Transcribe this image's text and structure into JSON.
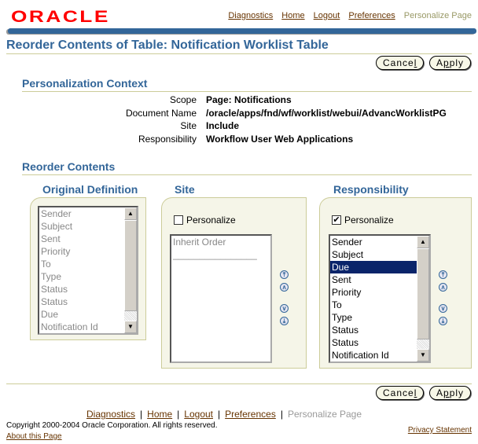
{
  "logo": "ORACLE",
  "global_nav": {
    "links": [
      "Diagnostics",
      "Home",
      "Logout",
      "Preferences"
    ],
    "disabled": "Personalize Page"
  },
  "page_title": "Reorder Contents of Table: Notification Worklist Table",
  "buttons": {
    "cancel": "Cance",
    "cancel_accel": "l",
    "apply_pre": "A",
    "apply_accel": "p",
    "apply_post": "ply"
  },
  "context": {
    "heading": "Personalization Context",
    "rows": [
      {
        "label": "Scope",
        "value": "Page: Notifications"
      },
      {
        "label": "Document Name",
        "value": "/oracle/apps/fnd/wf/worklist/webui/AdvancWorklistPG"
      },
      {
        "label": "Site",
        "value": "Include"
      },
      {
        "label": "Responsibility",
        "value": "Workflow User Web Applications"
      }
    ]
  },
  "reorder": {
    "heading": "Reorder Contents",
    "original": {
      "title": "Original Definition",
      "items": [
        "Sender",
        "Subject",
        "Sent",
        "Priority",
        "To",
        "Type",
        "Status",
        "Status",
        "Due",
        "Notification Id"
      ]
    },
    "site": {
      "title": "Site",
      "personalize_label": "Personalize",
      "personalize_checked": false,
      "items": [
        "Inherit Order"
      ],
      "divider": "________________"
    },
    "responsibility": {
      "title": "Responsibility",
      "personalize_label": "Personalize",
      "personalize_checked": true,
      "items": [
        "Sender",
        "Subject",
        "Due",
        "Sent",
        "Priority",
        "To",
        "Type",
        "Status",
        "Status",
        "Notification Id"
      ],
      "selected": "Due"
    }
  },
  "footer": {
    "links": [
      "Diagnostics",
      "Home",
      "Logout",
      "Preferences"
    ],
    "disabled": "Personalize Page",
    "copyright": "Copyright 2000-2004 Oracle Corporation. All rights reserved.",
    "about": "About this Page",
    "privacy": "Privacy Statement"
  }
}
